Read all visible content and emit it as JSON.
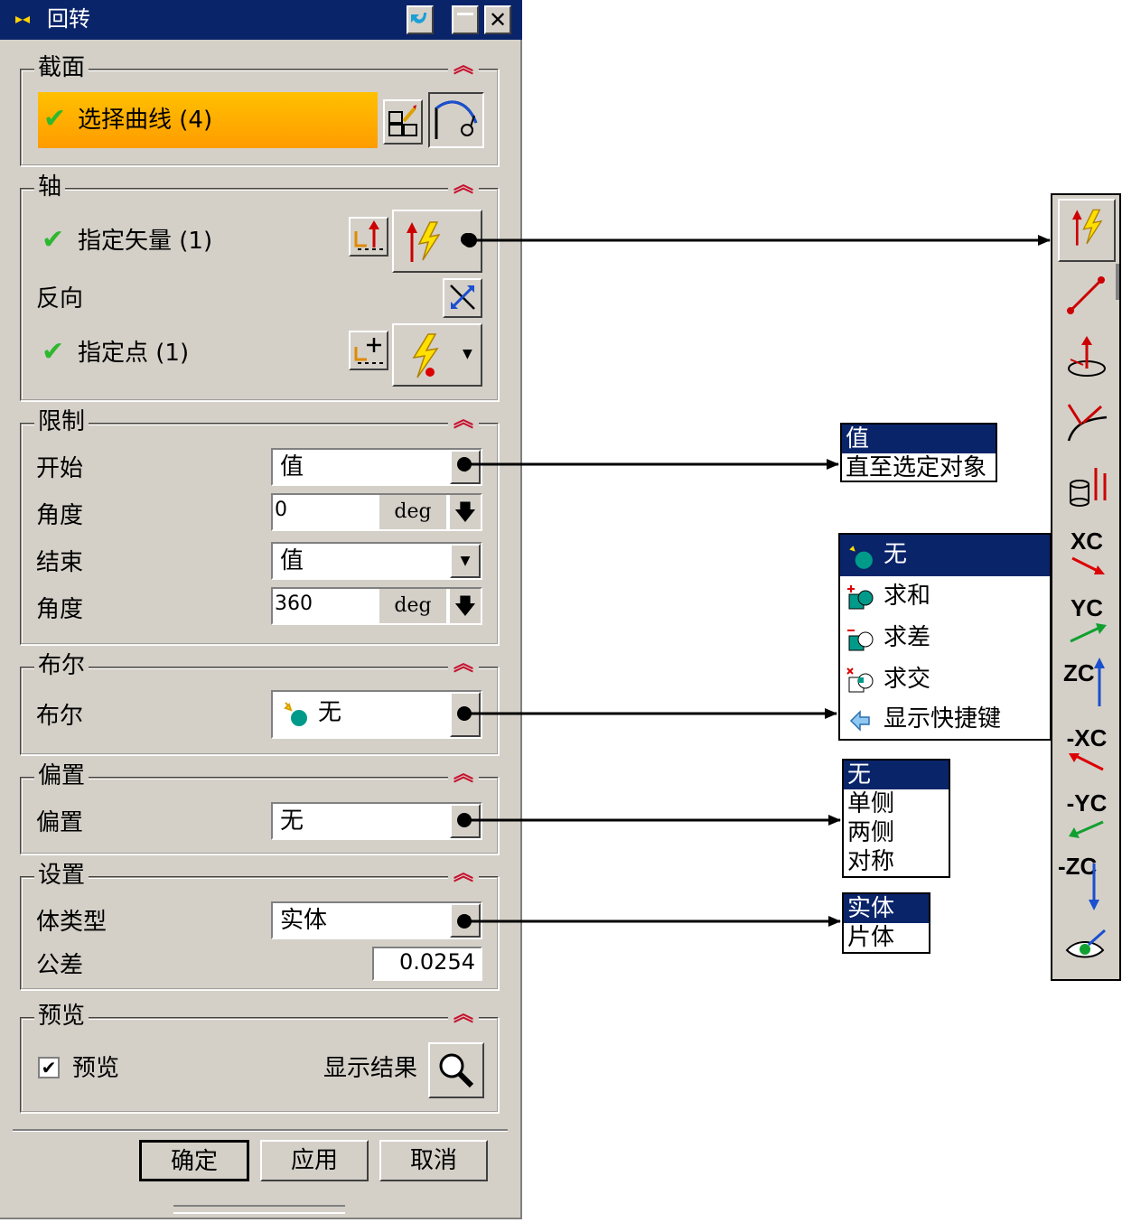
{
  "title": "回转",
  "title_buttons": {
    "help_icon": "back-arrow-icon",
    "minimize": "—",
    "close": "✕"
  },
  "colors": {
    "titlebar": "#0a246a",
    "selected_highlight": "#ffa500",
    "collapse": "#c8102e",
    "check": "#2fb82f"
  },
  "section": {
    "title": "截面",
    "select_curve": "选择曲线 (4)"
  },
  "axis": {
    "title": "轴",
    "specify_vector": "指定矢量 (1)",
    "reverse": "反向",
    "specify_point": "指定点 (1)"
  },
  "limits": {
    "title": "限制",
    "start_label": "开始",
    "start_value": "值",
    "start_angle_label": "角度",
    "start_angle": "0",
    "end_label": "结束",
    "end_value": "值",
    "end_angle_label": "角度",
    "end_angle": "360",
    "unit": "deg"
  },
  "boolean": {
    "title": "布尔",
    "label": "布尔",
    "value": "无"
  },
  "offset": {
    "title": "偏置",
    "label": "偏置",
    "value": "无"
  },
  "settings": {
    "title": "设置",
    "body_type_label": "体类型",
    "body_type_value": "实体",
    "tolerance_label": "公差",
    "tolerance_value": "0.0254"
  },
  "preview": {
    "title": "预览",
    "checkbox_label": "预览",
    "checked": true,
    "show_result": "显示结果"
  },
  "buttons": {
    "ok": "确定",
    "apply": "应用",
    "cancel": "取消"
  },
  "popups": {
    "start_options": [
      "值",
      "直至选定对象"
    ],
    "boolean_options": [
      "无",
      "求和",
      "求差",
      "求交",
      "显示快捷键"
    ],
    "offset_options": [
      "无",
      "单侧",
      "两侧",
      "对称"
    ],
    "body_type_options": [
      "实体",
      "片体"
    ]
  },
  "vector_toolbar": {
    "items": [
      "inferred-vector-icon",
      "two-points-icon",
      "normal-to-plane-icon",
      "curve-tangent-icon",
      "cylinder-axis-icon",
      "XC",
      "YC",
      "ZC",
      "-XC",
      "-YC",
      "-ZC",
      "view-direction-icon"
    ]
  }
}
